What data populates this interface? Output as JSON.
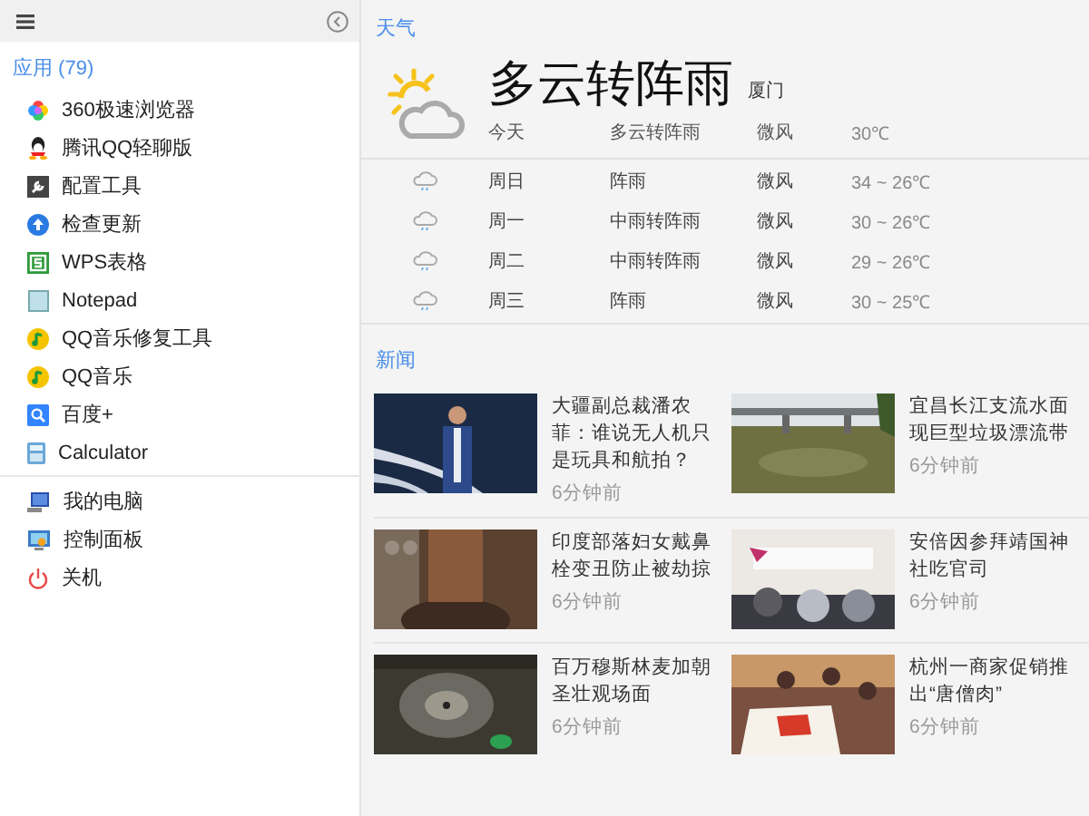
{
  "sidebar": {
    "section_label": "应用 (79)",
    "apps": [
      {
        "label": "360极速浏览器"
      },
      {
        "label": "腾讯QQ轻聊版"
      },
      {
        "label": "配置工具"
      },
      {
        "label": "检查更新"
      },
      {
        "label": "WPS表格"
      },
      {
        "label": "Notepad"
      },
      {
        "label": "QQ音乐修复工具"
      },
      {
        "label": "QQ音乐"
      },
      {
        "label": "百度+"
      },
      {
        "label": "Calculator"
      }
    ],
    "system": [
      {
        "label": "我的电脑"
      },
      {
        "label": "控制面板"
      },
      {
        "label": "关机"
      }
    ]
  },
  "weather": {
    "heading": "天气",
    "condition": "多云转阵雨",
    "city": "厦门",
    "today": {
      "day": "今天",
      "condition": "多云转阵雨",
      "wind": "微风",
      "temp": "30℃"
    },
    "forecast": [
      {
        "day": "周日",
        "condition": "阵雨",
        "wind": "微风",
        "temp": "34 ~ 26℃"
      },
      {
        "day": "周一",
        "condition": "中雨转阵雨",
        "wind": "微风",
        "temp": "30 ~ 26℃"
      },
      {
        "day": "周二",
        "condition": "中雨转阵雨",
        "wind": "微风",
        "temp": "29 ~ 26℃"
      },
      {
        "day": "周三",
        "condition": "阵雨",
        "wind": "微风",
        "temp": "30 ~ 25℃"
      }
    ]
  },
  "news": {
    "heading": "新闻",
    "items": [
      {
        "title": "大疆副总裁潘农菲：谁说无人机只是玩具和航拍？",
        "time": "6分钟前"
      },
      {
        "title": "宜昌长江支流水面现巨型垃圾漂流带",
        "time": "6分钟前"
      },
      {
        "title": "印度部落妇女戴鼻栓变丑防止被劫掠",
        "time": "6分钟前"
      },
      {
        "title": "安倍因参拜靖国神社吃官司",
        "time": "6分钟前"
      },
      {
        "title": "百万穆斯林麦加朝圣壮观场面",
        "time": "6分钟前"
      },
      {
        "title": "杭州一商家促销推出“唐僧肉”",
        "time": "6分钟前"
      }
    ]
  }
}
